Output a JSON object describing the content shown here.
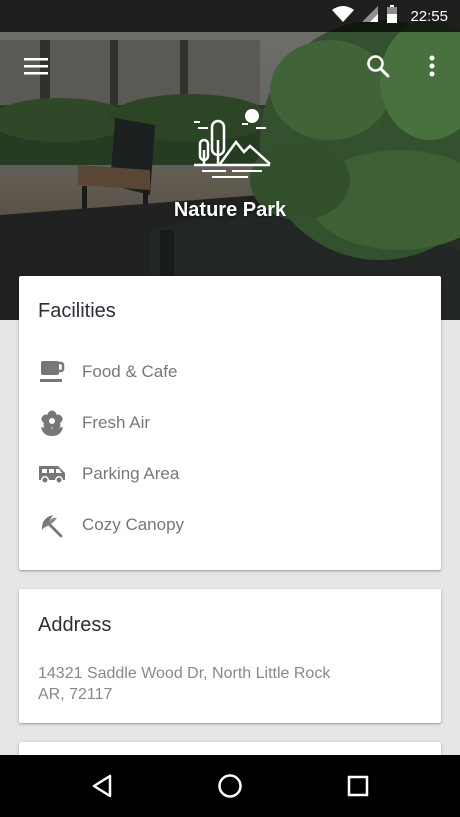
{
  "status_bar": {
    "time": "22:55"
  },
  "hero": {
    "title": "Nature Park"
  },
  "facilities": {
    "title": "Facilities",
    "items": [
      {
        "label": "Food & Cafe",
        "icon": "coffee-cup-icon"
      },
      {
        "label": "Fresh Air",
        "icon": "flower-icon"
      },
      {
        "label": "Parking Area",
        "icon": "bus-icon"
      },
      {
        "label": "Cozy Canopy",
        "icon": "umbrella-icon"
      }
    ]
  },
  "address": {
    "title": "Address",
    "line1": "14321 Saddle Wood Dr, North Little Rock",
    "line2": "AR, 72117"
  },
  "colors": {
    "icon_gray": "#777777",
    "title": "#2b2f3a",
    "body_text": "#888888"
  }
}
